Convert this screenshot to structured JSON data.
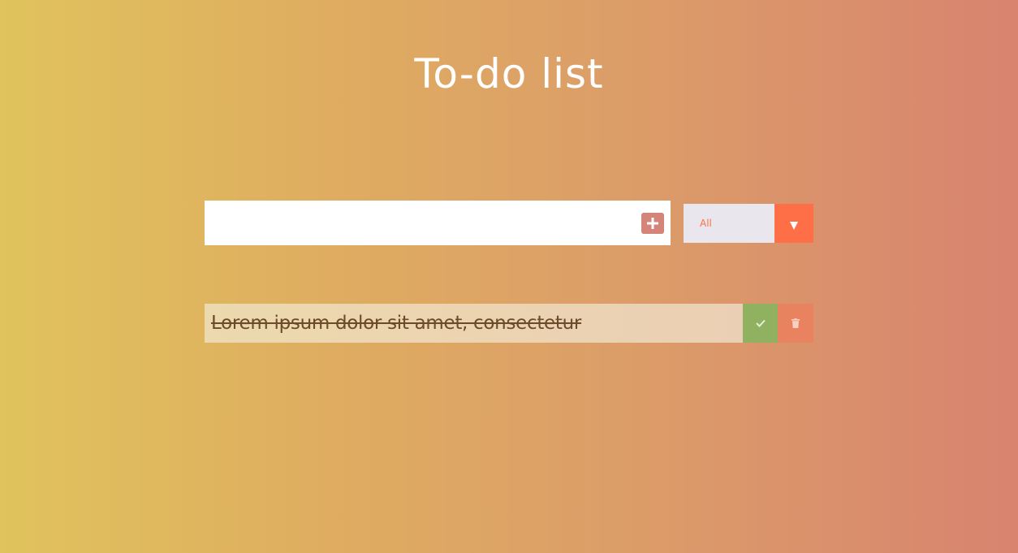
{
  "header": {
    "title": "To-do list"
  },
  "todo_form": {
    "input_value": "",
    "input_placeholder": "",
    "add_icon": "plus-square-icon",
    "filter": {
      "selected": "All",
      "arrow_icon": "caret-down-icon"
    }
  },
  "todos": [
    {
      "text": "Lorem ipsum dolor sit amet, consectetur",
      "completed": true,
      "complete_icon": "check-icon",
      "delete_icon": "trash-icon"
    }
  ],
  "colors": {
    "accent": "#ff6f47",
    "add_button": "#d5847a",
    "complete_button": "#90b260",
    "delete_button": "#e9825f",
    "filter_bg": "#eae6ee"
  }
}
